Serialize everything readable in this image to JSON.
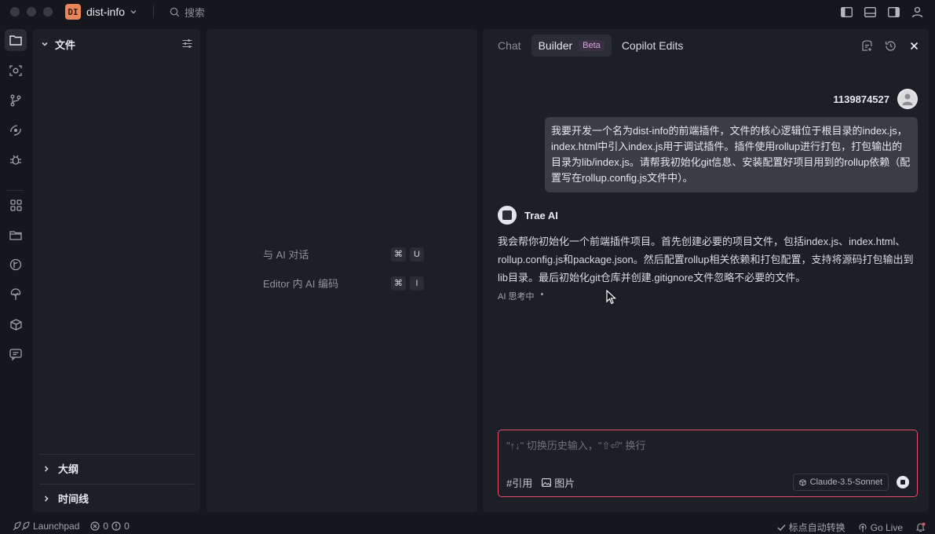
{
  "titlebar": {
    "project_badge": "DI",
    "project_name": "dist-info",
    "search_placeholder": "搜索"
  },
  "explorer": {
    "title": "文件",
    "outline_label": "大纲",
    "timeline_label": "时间线"
  },
  "editor_hints": [
    {
      "label": "与 AI 对话",
      "keys": [
        "⌘",
        "U"
      ]
    },
    {
      "label": "Editor 内 AI 编码",
      "keys": [
        "⌘",
        "I"
      ]
    }
  ],
  "chat": {
    "tabs": [
      {
        "label": "Chat"
      },
      {
        "label": "Builder",
        "badge": "Beta"
      },
      {
        "label": "Copilot Edits"
      }
    ],
    "active_tab": "Builder",
    "user_name": "1139874527",
    "user_message": "我要开发一个名为dist-info的前端插件，文件的核心逻辑位于根目录的index.js，index.html中引入index.js用于调试插件。插件使用rollup进行打包，打包输出的目录为lib/index.js。请帮我初始化git信息、安装配置好项目用到的rollup依赖（配置写在rollup.config.js文件中）。",
    "ai_name": "Trae AI",
    "ai_message": "我会帮你初始化一个前端插件项目。首先创建必要的项目文件，包括index.js、index.html、rollup.config.js和package.json。然后配置rollup相关依赖和打包配置，支持将源码打包输出到lib目录。最后初始化git仓库并创建.gitignore文件忽略不必要的文件。",
    "ai_status": "AI 思考中",
    "ai_status_dot": "•",
    "input_placeholder": "\"↑↓\" 切换历史输入，\"⇧⏎\" 换行",
    "attach_reference": "#引用",
    "attach_image": "图片",
    "model_name": "Claude-3.5-Sonnet"
  },
  "statusbar": {
    "launchpad": "Launchpad",
    "errors": "0",
    "warnings": "0",
    "punct_convert": "标点自动转换",
    "go_live": "Go Live"
  },
  "colors": {
    "accent_badge": "#e9865a",
    "input_border": "#e04f6b",
    "panel_bg": "#1d1f27",
    "app_bg": "#16171d",
    "beta_text": "#d2a4d8"
  }
}
